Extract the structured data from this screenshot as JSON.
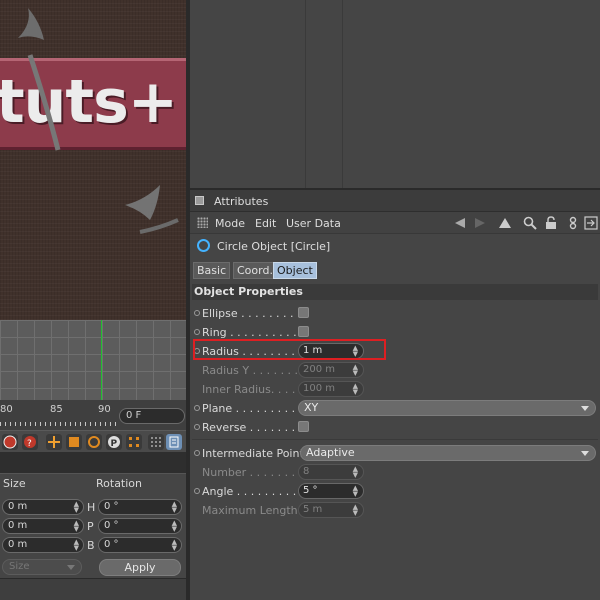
{
  "viewport": {
    "banner_text": "tuts+"
  },
  "timeline": {
    "ticks": [
      "80",
      "85",
      "90"
    ],
    "frame": "0 F"
  },
  "coordinates": {
    "size_header": "Size",
    "rotation_header": "Rotation",
    "rows": [
      {
        "size": "0 m",
        "axis": "H",
        "rot": "0 °"
      },
      {
        "size": "0 m",
        "axis": "P",
        "rot": "0 °"
      },
      {
        "size": "0 m",
        "axis": "B",
        "rot": "0 °"
      }
    ],
    "size_mode": "Size",
    "apply_label": "Apply"
  },
  "attributes": {
    "title": "Attributes",
    "menu": [
      "Mode",
      "Edit",
      "User Data"
    ],
    "object_name": "Circle Object [Circle]",
    "tabs": [
      "Basic",
      "Coord.",
      "Object"
    ],
    "active_tab": "Object",
    "section": "Object Properties",
    "props": {
      "ellipse": "Ellipse . . . . . . . . . .",
      "ring": "Ring . . . . . . . . . . .",
      "radius_label": "Radius . . . . . . . . .",
      "radius_value": "1 m",
      "radius_y_label": "Radius Y . . . . . . .",
      "radius_y_value": "200 m",
      "inner_radius_label": "Inner Radius. . . . .",
      "inner_radius_value": "100 m",
      "plane_label": "Plane . . . . . . . . . .",
      "plane_value": "XY",
      "reverse_label": "Reverse . . . . . . . .",
      "intermediate_label": "Intermediate Points",
      "intermediate_value": "Adaptive",
      "number_label": "Number . . . . . . . .",
      "number_value": "8",
      "angle_label": "Angle . . . . . . . . . .",
      "angle_value": "5 °",
      "max_length_label": "Maximum Length",
      "max_length_value": "5 m"
    }
  },
  "colors": {
    "highlight": "#dd1f22",
    "active_tab": "#a7c0dc",
    "circle_icon": "#44b3ff",
    "y_axis": "#1fbf2f"
  }
}
